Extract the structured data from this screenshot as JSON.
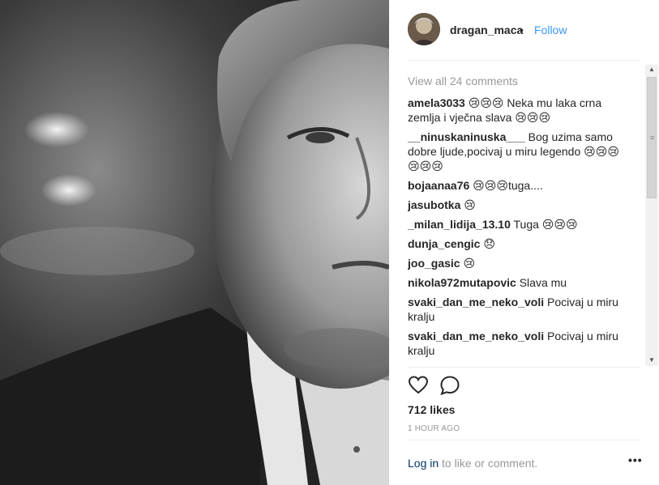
{
  "post": {
    "username": "dragan_maca",
    "separator": "•",
    "follow_label": "Follow"
  },
  "comments": {
    "view_all": "View all 24 comments",
    "items": [
      {
        "user": "amela3033",
        "text": "😢😢😢 Neka mu laka crna zemlja i vječna slava 😢😢😢"
      },
      {
        "user": "__ninuskaninuska___",
        "text": "Bog uzima samo dobre ljude,pocivaj u miru legendo 😢😢😢😢😢😢"
      },
      {
        "user": "bojaanaa76",
        "text": "😢😢😢tuga...."
      },
      {
        "user": "jasubotka",
        "text": "😢"
      },
      {
        "user": "_milan_lidija_13.10",
        "text": "Tuga 😢😢😢"
      },
      {
        "user": "dunja_cengic",
        "text": "😞"
      },
      {
        "user": "joo_gasic",
        "text": "😢"
      },
      {
        "user": "nikola972mutapovic",
        "text": "Slava mu"
      },
      {
        "user": "svaki_dan_me_neko_voli",
        "text": "Pocivaj u miru kralju"
      },
      {
        "user": "svaki_dan_me_neko_voli",
        "text": "Pocivaj u miru kralju"
      }
    ]
  },
  "actions": {
    "like_icon": "heart-icon",
    "comment_icon": "comment-bubble-icon"
  },
  "likes": "712 likes",
  "timestamp": "1 HOUR AGO",
  "footer": {
    "login_label": "Log in",
    "rest": " to like or comment.",
    "more_label": "•••"
  },
  "colors": {
    "link_blue": "#3897f0",
    "login_navy": "#003569",
    "muted_gray": "#999999",
    "text_dark": "#262626"
  }
}
